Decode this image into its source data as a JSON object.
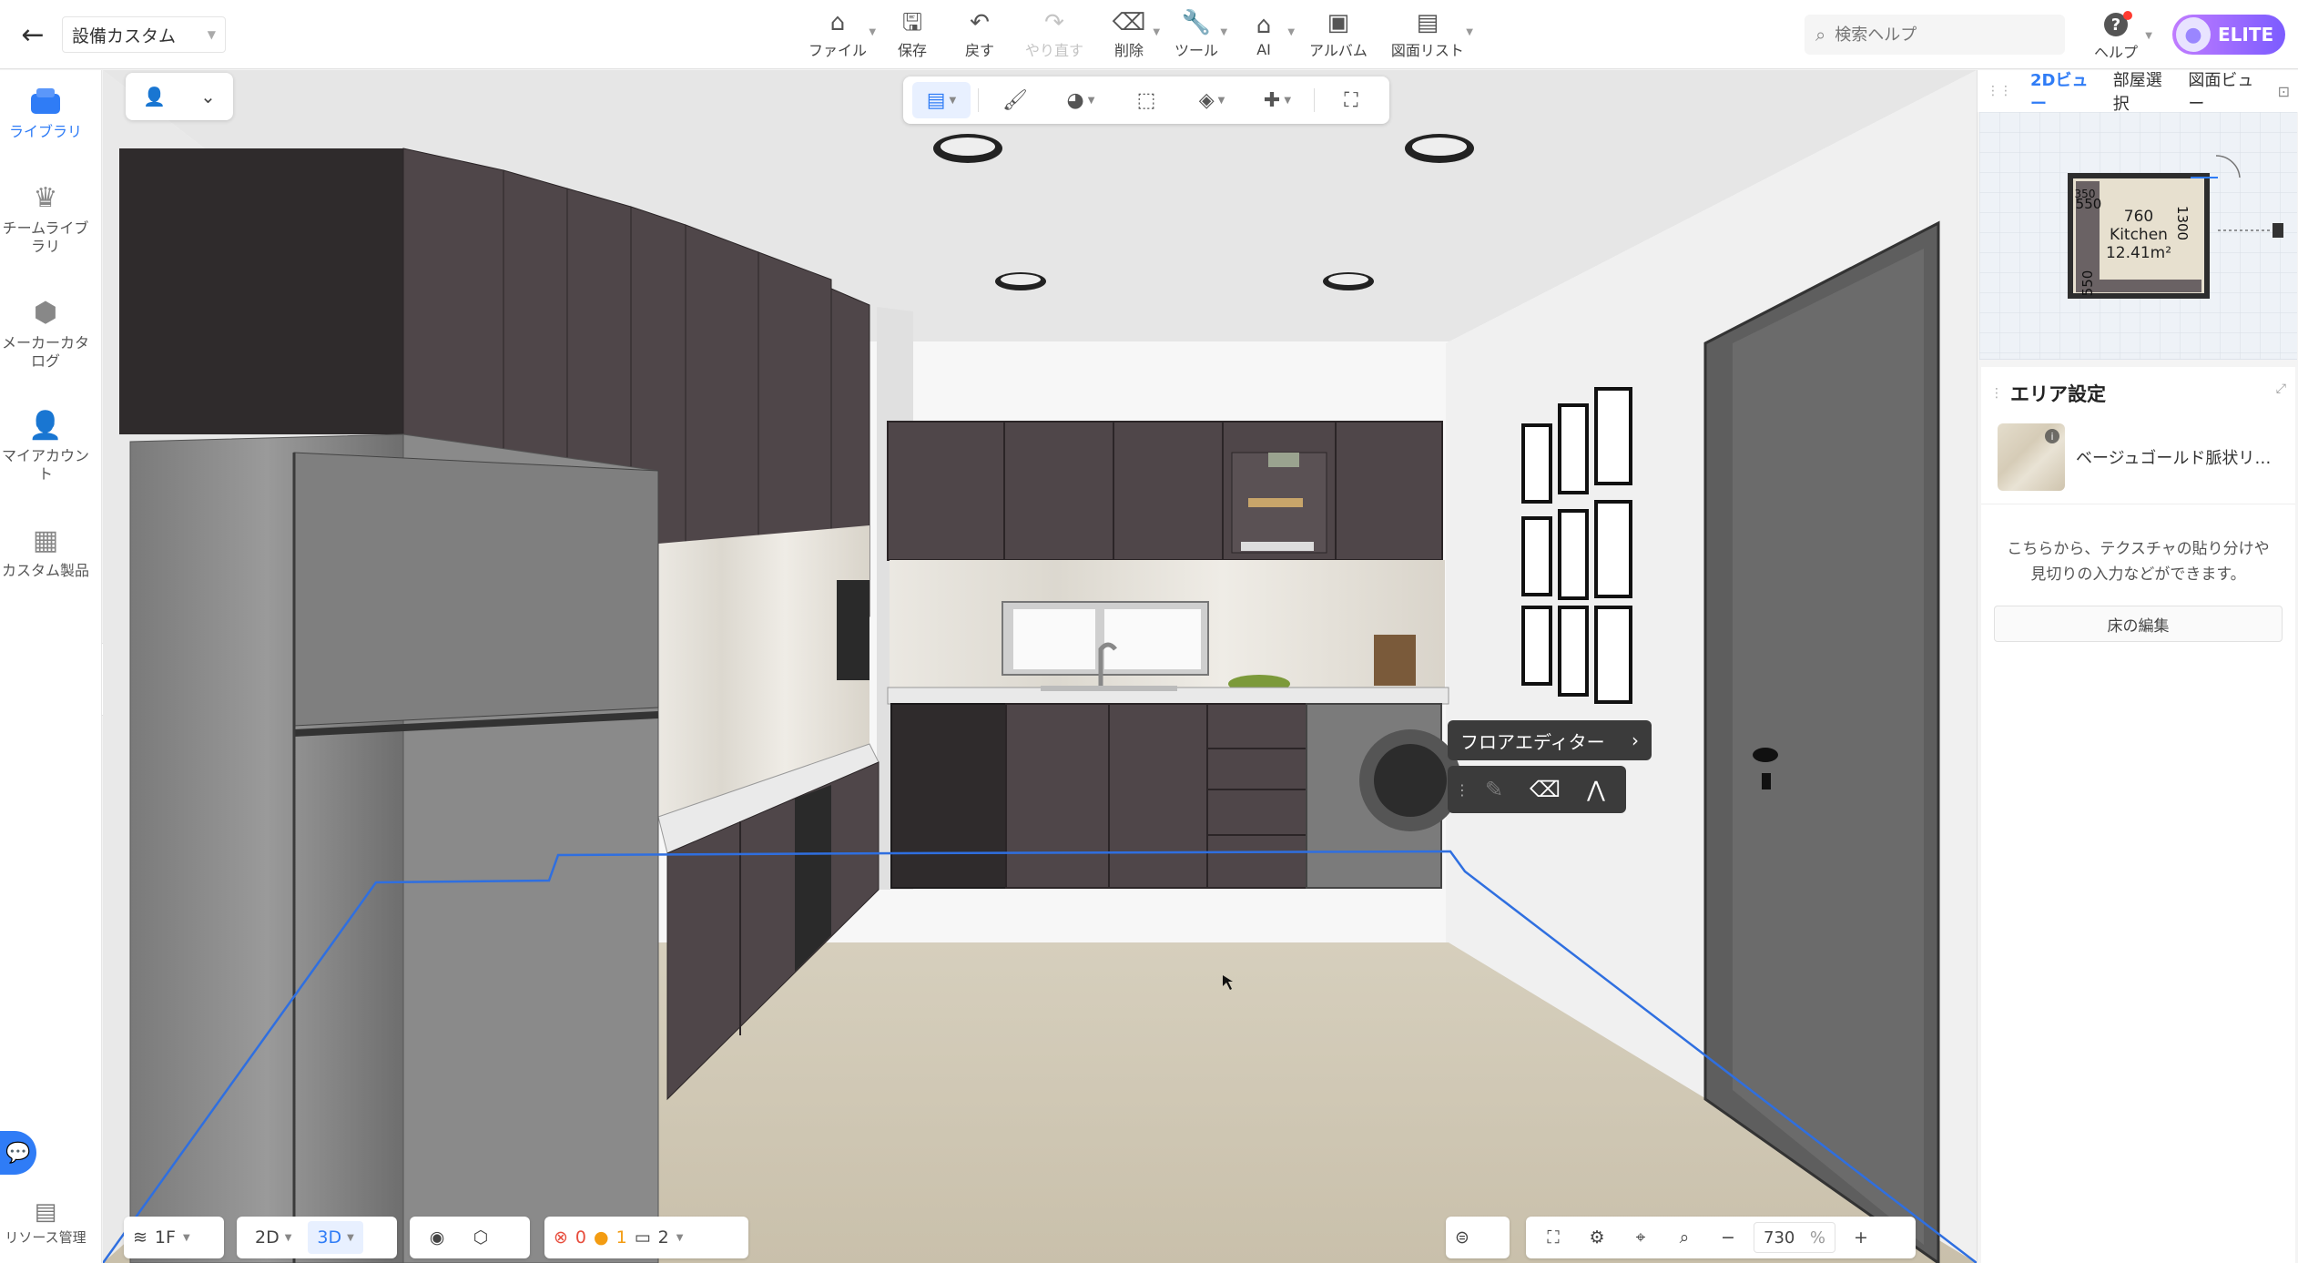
{
  "header": {
    "project_name": "設備カスタム",
    "toolbar": [
      {
        "label": "ファイル",
        "icon": "file-icon",
        "dropdown": true
      },
      {
        "label": "保存",
        "icon": "save-icon",
        "dropdown": false
      },
      {
        "label": "戻す",
        "icon": "undo-icon",
        "dropdown": false
      },
      {
        "label": "やり直す",
        "icon": "redo-icon",
        "dropdown": false,
        "disabled": true
      },
      {
        "label": "削除",
        "icon": "eraser-icon",
        "dropdown": true
      },
      {
        "label": "ツール",
        "icon": "wrench-icon",
        "dropdown": true
      },
      {
        "label": "AI",
        "icon": "ai-house-icon",
        "dropdown": true
      },
      {
        "label": "アルバム",
        "icon": "album-icon",
        "dropdown": false
      },
      {
        "label": "図面リスト",
        "icon": "drawing-list-icon",
        "dropdown": true
      }
    ],
    "search_placeholder": "検索ヘルプ",
    "help_label": "ヘルプ",
    "badge_label": "ELITE"
  },
  "sidebar": {
    "items": [
      {
        "label": "ライブラリ",
        "icon": "library-icon",
        "active": true
      },
      {
        "label": "チームライブラリ",
        "icon": "team-library-icon",
        "active": false
      },
      {
        "label": "メーカーカタログ",
        "icon": "maker-catalog-icon",
        "active": false
      },
      {
        "label": "マイアカウント",
        "icon": "account-icon",
        "active": false
      },
      {
        "label": "カスタム製品",
        "icon": "custom-product-icon",
        "active": false
      }
    ],
    "resource_label": "リソース管理"
  },
  "viewport": {
    "floor_editor_label": "フロアエディター",
    "plan_labels": {
      "room_name": "Kitchen",
      "area": "12.41m²",
      "dim_top": "760",
      "dim_left_top": "550",
      "dim_right": "1300",
      "dim_left_bottom": "550",
      "dim_small": "350"
    }
  },
  "bottombar": {
    "floor": "1F",
    "view_2d": "2D",
    "view_3d": "3D",
    "active_view": "3D",
    "errors": "0",
    "warnings": "1",
    "layouts": "2",
    "zoom": "730",
    "zoom_unit": "%"
  },
  "rightpanel": {
    "tabs": [
      "2Dビュー",
      "部屋選択",
      "図面ビュー"
    ],
    "active_tab": "2Dビュー",
    "area_title": "エリア設定",
    "material_name": "ベージュゴールド脈状リ…",
    "help_text": "こちらから、テクスチャの貼り分けや見切りの入力などができます。",
    "floor_edit_button": "床の編集"
  },
  "colors": {
    "accent": "#2f7cf6",
    "cabinet": "#4d4446",
    "floor": "#d8d0bd",
    "selection": "#2f6fe0"
  }
}
